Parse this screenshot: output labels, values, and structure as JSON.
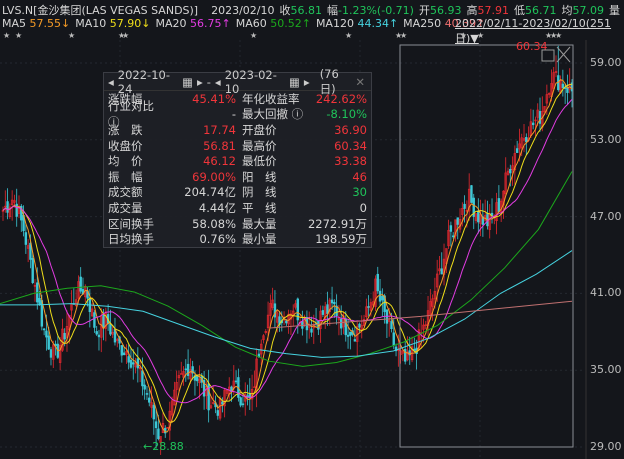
{
  "header": {
    "symbol": "LVS.N[金沙集团(LAS VEGAS SANDS)]",
    "date": "2023/02/10",
    "close_label": "收",
    "close": "56.81",
    "chg_label": "幅",
    "chg": "-1.23%(-0.71)",
    "open_label": "开",
    "open": "56.93",
    "high_label": "高",
    "high": "57.91",
    "low_label": "低",
    "low": "56.71",
    "avg_label": "均",
    "avg": "57.09",
    "vol_label": "量"
  },
  "ma": [
    {
      "label": "MA5",
      "value": "57.55↓",
      "color": "#f49a26"
    },
    {
      "label": "MA10",
      "value": "57.90↓",
      "color": "#eedd1a"
    },
    {
      "label": "MA20",
      "value": "56.75↑",
      "color": "#e23ce2"
    },
    {
      "label": "MA60",
      "value": "50.52↑",
      "color": "#1ca81c"
    },
    {
      "label": "MA120",
      "value": "44.34↑",
      "color": "#46d3e0"
    },
    {
      "label": "MA250",
      "value": "40.39↑",
      "color": "#f07070"
    }
  ],
  "range": "2022/02/11-2023/02/10(251日)▼",
  "tooltip": {
    "start": "2022-10-24",
    "sep": "-",
    "end": "2023-02-10",
    "days": "(76日)",
    "rows": [
      [
        "涨跌幅",
        "45.41%",
        "r",
        "年化收益率",
        "242.62%",
        "r"
      ],
      [
        "行业对比 ⓘ",
        "-",
        "w",
        "最大回撤 ⓘ",
        "-8.10%",
        "g"
      ],
      [
        "涨　跌",
        "17.74",
        "r",
        "开盘价",
        "36.90",
        "r"
      ],
      [
        "收盘价",
        "56.81",
        "r",
        "最高价",
        "60.34",
        "r"
      ],
      [
        "均　价",
        "46.12",
        "r",
        "最低价",
        "33.38",
        "r"
      ],
      [
        "振　幅",
        "69.00%",
        "r",
        "阳　线",
        "46",
        "r"
      ],
      [
        "成交额",
        "204.74亿",
        "w",
        "阴　线",
        "30",
        "g"
      ],
      [
        "成交量",
        "4.44亿",
        "w",
        "平　线",
        "0",
        "w"
      ],
      [
        "区间换手",
        "58.08%",
        "w",
        "最大量",
        "2272.91万",
        "w"
      ],
      [
        "日均换手",
        "0.76%",
        "w",
        "最小量",
        "198.59万",
        "w"
      ]
    ]
  },
  "chart_data": {
    "type": "candlestick",
    "ylim": [
      27.5,
      62
    ],
    "yticks": [
      "59.00",
      "53.00",
      "47.00",
      "41.00",
      "35.00",
      "29.00"
    ],
    "max_label": "60.34",
    "min_label": "←28.88",
    "max_value": 60.34,
    "min_value": 28.88,
    "close_keypoints": [
      47.5,
      48.5,
      46,
      42,
      38,
      36,
      38,
      41,
      41.5,
      38,
      39,
      37,
      36.5,
      35,
      33,
      30,
      31,
      34,
      35.5,
      34,
      32.5,
      32,
      34,
      33,
      32.5,
      38,
      40,
      39,
      40,
      39,
      38.5,
      39.5,
      40,
      38.5,
      38,
      39,
      41.5,
      39,
      36.5,
      35.5,
      37,
      39,
      42,
      45,
      47,
      48.5,
      47,
      46.5,
      48,
      51,
      53,
      54,
      55,
      58,
      57.5,
      56.81
    ],
    "ma60": [
      40.2,
      41,
      41.4,
      41.6,
      41.1,
      40,
      38.5,
      36.8,
      35.7,
      35.3,
      35.6,
      36.3,
      37.2,
      38.5,
      40.5,
      43,
      46,
      50.52
    ],
    "ma120": [
      40.1,
      40.1,
      40.2,
      40.0,
      39.6,
      38.6,
      37.6,
      36.7,
      36.3,
      36.0,
      36.1,
      36.5,
      37.5,
      39,
      41,
      42.5,
      44.34
    ],
    "ma250": [
      38.3,
      38.6,
      38.9,
      39.2,
      39.6,
      40.0,
      40.39
    ]
  }
}
